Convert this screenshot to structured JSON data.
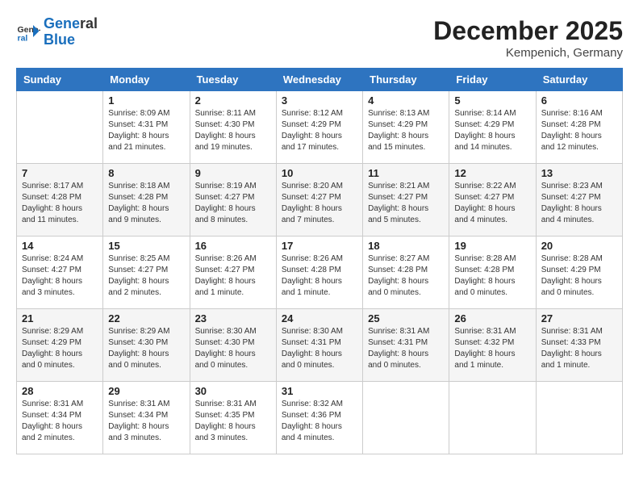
{
  "header": {
    "logo_line1": "General",
    "logo_line2": "Blue",
    "month": "December 2025",
    "location": "Kempenich, Germany"
  },
  "days_of_week": [
    "Sunday",
    "Monday",
    "Tuesday",
    "Wednesday",
    "Thursday",
    "Friday",
    "Saturday"
  ],
  "weeks": [
    [
      {
        "day": "",
        "info": ""
      },
      {
        "day": "1",
        "info": "Sunrise: 8:09 AM\nSunset: 4:31 PM\nDaylight: 8 hours\nand 21 minutes."
      },
      {
        "day": "2",
        "info": "Sunrise: 8:11 AM\nSunset: 4:30 PM\nDaylight: 8 hours\nand 19 minutes."
      },
      {
        "day": "3",
        "info": "Sunrise: 8:12 AM\nSunset: 4:29 PM\nDaylight: 8 hours\nand 17 minutes."
      },
      {
        "day": "4",
        "info": "Sunrise: 8:13 AM\nSunset: 4:29 PM\nDaylight: 8 hours\nand 15 minutes."
      },
      {
        "day": "5",
        "info": "Sunrise: 8:14 AM\nSunset: 4:29 PM\nDaylight: 8 hours\nand 14 minutes."
      },
      {
        "day": "6",
        "info": "Sunrise: 8:16 AM\nSunset: 4:28 PM\nDaylight: 8 hours\nand 12 minutes."
      }
    ],
    [
      {
        "day": "7",
        "info": "Sunrise: 8:17 AM\nSunset: 4:28 PM\nDaylight: 8 hours\nand 11 minutes."
      },
      {
        "day": "8",
        "info": "Sunrise: 8:18 AM\nSunset: 4:28 PM\nDaylight: 8 hours\nand 9 minutes."
      },
      {
        "day": "9",
        "info": "Sunrise: 8:19 AM\nSunset: 4:27 PM\nDaylight: 8 hours\nand 8 minutes."
      },
      {
        "day": "10",
        "info": "Sunrise: 8:20 AM\nSunset: 4:27 PM\nDaylight: 8 hours\nand 7 minutes."
      },
      {
        "day": "11",
        "info": "Sunrise: 8:21 AM\nSunset: 4:27 PM\nDaylight: 8 hours\nand 5 minutes."
      },
      {
        "day": "12",
        "info": "Sunrise: 8:22 AM\nSunset: 4:27 PM\nDaylight: 8 hours\nand 4 minutes."
      },
      {
        "day": "13",
        "info": "Sunrise: 8:23 AM\nSunset: 4:27 PM\nDaylight: 8 hours\nand 4 minutes."
      }
    ],
    [
      {
        "day": "14",
        "info": "Sunrise: 8:24 AM\nSunset: 4:27 PM\nDaylight: 8 hours\nand 3 minutes."
      },
      {
        "day": "15",
        "info": "Sunrise: 8:25 AM\nSunset: 4:27 PM\nDaylight: 8 hours\nand 2 minutes."
      },
      {
        "day": "16",
        "info": "Sunrise: 8:26 AM\nSunset: 4:27 PM\nDaylight: 8 hours\nand 1 minute."
      },
      {
        "day": "17",
        "info": "Sunrise: 8:26 AM\nSunset: 4:28 PM\nDaylight: 8 hours\nand 1 minute."
      },
      {
        "day": "18",
        "info": "Sunrise: 8:27 AM\nSunset: 4:28 PM\nDaylight: 8 hours\nand 0 minutes."
      },
      {
        "day": "19",
        "info": "Sunrise: 8:28 AM\nSunset: 4:28 PM\nDaylight: 8 hours\nand 0 minutes."
      },
      {
        "day": "20",
        "info": "Sunrise: 8:28 AM\nSunset: 4:29 PM\nDaylight: 8 hours\nand 0 minutes."
      }
    ],
    [
      {
        "day": "21",
        "info": "Sunrise: 8:29 AM\nSunset: 4:29 PM\nDaylight: 8 hours\nand 0 minutes."
      },
      {
        "day": "22",
        "info": "Sunrise: 8:29 AM\nSunset: 4:30 PM\nDaylight: 8 hours\nand 0 minutes."
      },
      {
        "day": "23",
        "info": "Sunrise: 8:30 AM\nSunset: 4:30 PM\nDaylight: 8 hours\nand 0 minutes."
      },
      {
        "day": "24",
        "info": "Sunrise: 8:30 AM\nSunset: 4:31 PM\nDaylight: 8 hours\nand 0 minutes."
      },
      {
        "day": "25",
        "info": "Sunrise: 8:31 AM\nSunset: 4:31 PM\nDaylight: 8 hours\nand 0 minutes."
      },
      {
        "day": "26",
        "info": "Sunrise: 8:31 AM\nSunset: 4:32 PM\nDaylight: 8 hours\nand 1 minute."
      },
      {
        "day": "27",
        "info": "Sunrise: 8:31 AM\nSunset: 4:33 PM\nDaylight: 8 hours\nand 1 minute."
      }
    ],
    [
      {
        "day": "28",
        "info": "Sunrise: 8:31 AM\nSunset: 4:34 PM\nDaylight: 8 hours\nand 2 minutes."
      },
      {
        "day": "29",
        "info": "Sunrise: 8:31 AM\nSunset: 4:34 PM\nDaylight: 8 hours\nand 3 minutes."
      },
      {
        "day": "30",
        "info": "Sunrise: 8:31 AM\nSunset: 4:35 PM\nDaylight: 8 hours\nand 3 minutes."
      },
      {
        "day": "31",
        "info": "Sunrise: 8:32 AM\nSunset: 4:36 PM\nDaylight: 8 hours\nand 4 minutes."
      },
      {
        "day": "",
        "info": ""
      },
      {
        "day": "",
        "info": ""
      },
      {
        "day": "",
        "info": ""
      }
    ]
  ]
}
